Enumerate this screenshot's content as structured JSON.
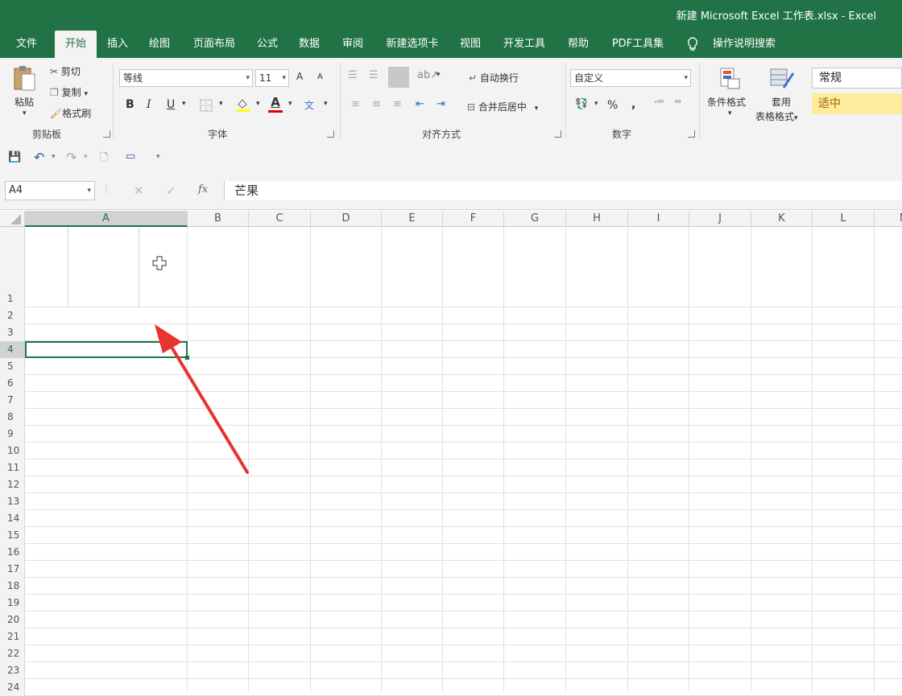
{
  "window": {
    "title": "新建 Microsoft Excel 工作表.xlsx  -  Excel"
  },
  "tabs": [
    "文件",
    "开始",
    "插入",
    "绘图",
    "页面布局",
    "公式",
    "数据",
    "审阅",
    "新建选项卡",
    "视图",
    "开发工具",
    "帮助",
    "PDF工具集"
  ],
  "active_tab": "开始",
  "tell_me": "操作说明搜索",
  "clipboard": {
    "paste": "粘贴",
    "cut": "剪切",
    "copy": "复制",
    "format_painter": "格式刷",
    "group": "剪贴板"
  },
  "font": {
    "name": "等线",
    "size": "11",
    "grow": "A",
    "shrink": "A",
    "bold": "B",
    "italic": "I",
    "underline": "U",
    "font_color_letter": "A",
    "phonetic": "文",
    "group": "字体"
  },
  "alignment": {
    "wrap_text": "自动换行",
    "merge_center": "合并后居中",
    "group": "对齐方式"
  },
  "number": {
    "format": "自定义",
    "percent": "%",
    "comma": ",",
    "group": "数字"
  },
  "styles": {
    "conditional": "条件格式",
    "table_style_line1": "套用",
    "table_style_line2": "表格格式",
    "normal": "常规",
    "neutral": "适中"
  },
  "formula_bar": {
    "name_box": "A4",
    "fx": "fx",
    "value": "芒果"
  },
  "columns": [
    "A",
    "B",
    "C",
    "D",
    "E",
    "F",
    "G",
    "H",
    "I",
    "J",
    "K",
    "L",
    "M"
  ],
  "rows": [
    "1",
    "2",
    "3",
    "4",
    "5",
    "6",
    "7",
    "8",
    "9",
    "10",
    "11",
    "12",
    "13",
    "14",
    "15",
    "16",
    "17",
    "18",
    "19",
    "20",
    "21",
    "22",
    "23",
    "24"
  ],
  "selected_cell": "A4",
  "colors": {
    "accent": "#217346",
    "ribbon": "#f3f3f3",
    "arrow": "#e8332e",
    "neutral_fill": "#ffeb9c",
    "neutral_text": "#9c6500"
  }
}
